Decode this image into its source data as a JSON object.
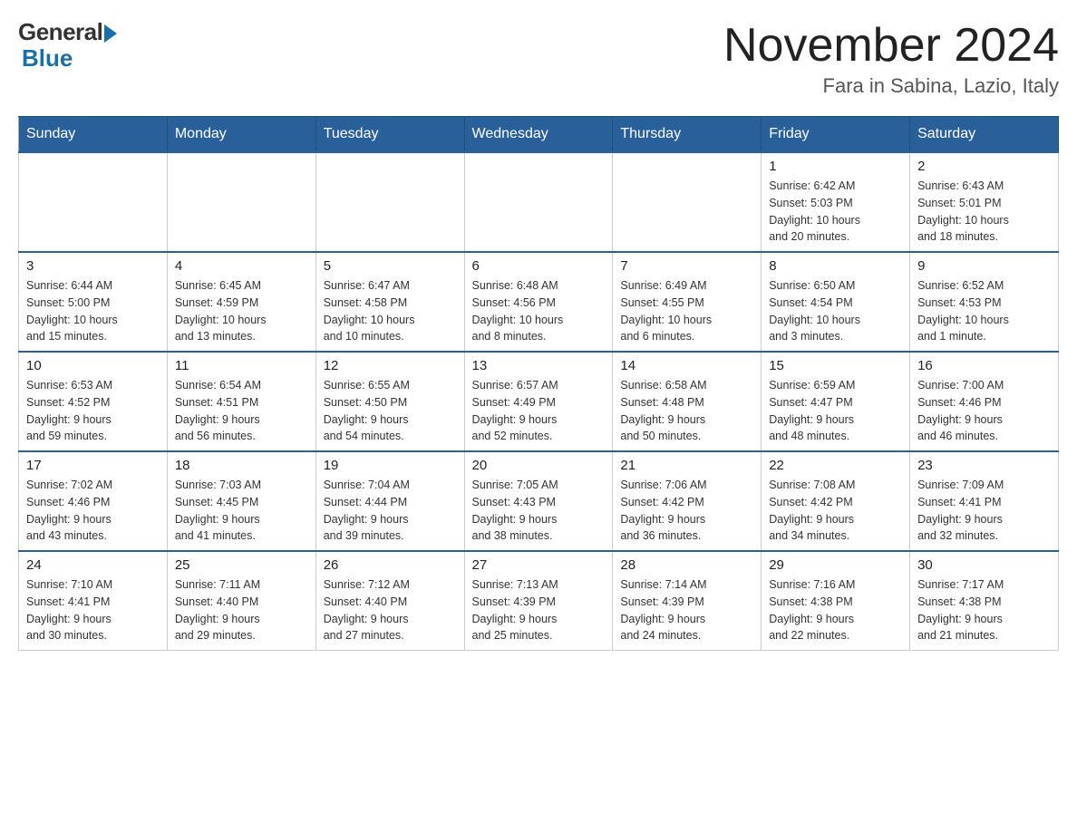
{
  "logo": {
    "general_text": "General",
    "blue_text": "Blue"
  },
  "header": {
    "title": "November 2024",
    "location": "Fara in Sabina, Lazio, Italy"
  },
  "days_of_week": [
    "Sunday",
    "Monday",
    "Tuesday",
    "Wednesday",
    "Thursday",
    "Friday",
    "Saturday"
  ],
  "weeks": [
    [
      {
        "day": "",
        "info": ""
      },
      {
        "day": "",
        "info": ""
      },
      {
        "day": "",
        "info": ""
      },
      {
        "day": "",
        "info": ""
      },
      {
        "day": "",
        "info": ""
      },
      {
        "day": "1",
        "info": "Sunrise: 6:42 AM\nSunset: 5:03 PM\nDaylight: 10 hours\nand 20 minutes."
      },
      {
        "day": "2",
        "info": "Sunrise: 6:43 AM\nSunset: 5:01 PM\nDaylight: 10 hours\nand 18 minutes."
      }
    ],
    [
      {
        "day": "3",
        "info": "Sunrise: 6:44 AM\nSunset: 5:00 PM\nDaylight: 10 hours\nand 15 minutes."
      },
      {
        "day": "4",
        "info": "Sunrise: 6:45 AM\nSunset: 4:59 PM\nDaylight: 10 hours\nand 13 minutes."
      },
      {
        "day": "5",
        "info": "Sunrise: 6:47 AM\nSunset: 4:58 PM\nDaylight: 10 hours\nand 10 minutes."
      },
      {
        "day": "6",
        "info": "Sunrise: 6:48 AM\nSunset: 4:56 PM\nDaylight: 10 hours\nand 8 minutes."
      },
      {
        "day": "7",
        "info": "Sunrise: 6:49 AM\nSunset: 4:55 PM\nDaylight: 10 hours\nand 6 minutes."
      },
      {
        "day": "8",
        "info": "Sunrise: 6:50 AM\nSunset: 4:54 PM\nDaylight: 10 hours\nand 3 minutes."
      },
      {
        "day": "9",
        "info": "Sunrise: 6:52 AM\nSunset: 4:53 PM\nDaylight: 10 hours\nand 1 minute."
      }
    ],
    [
      {
        "day": "10",
        "info": "Sunrise: 6:53 AM\nSunset: 4:52 PM\nDaylight: 9 hours\nand 59 minutes."
      },
      {
        "day": "11",
        "info": "Sunrise: 6:54 AM\nSunset: 4:51 PM\nDaylight: 9 hours\nand 56 minutes."
      },
      {
        "day": "12",
        "info": "Sunrise: 6:55 AM\nSunset: 4:50 PM\nDaylight: 9 hours\nand 54 minutes."
      },
      {
        "day": "13",
        "info": "Sunrise: 6:57 AM\nSunset: 4:49 PM\nDaylight: 9 hours\nand 52 minutes."
      },
      {
        "day": "14",
        "info": "Sunrise: 6:58 AM\nSunset: 4:48 PM\nDaylight: 9 hours\nand 50 minutes."
      },
      {
        "day": "15",
        "info": "Sunrise: 6:59 AM\nSunset: 4:47 PM\nDaylight: 9 hours\nand 48 minutes."
      },
      {
        "day": "16",
        "info": "Sunrise: 7:00 AM\nSunset: 4:46 PM\nDaylight: 9 hours\nand 46 minutes."
      }
    ],
    [
      {
        "day": "17",
        "info": "Sunrise: 7:02 AM\nSunset: 4:46 PM\nDaylight: 9 hours\nand 43 minutes."
      },
      {
        "day": "18",
        "info": "Sunrise: 7:03 AM\nSunset: 4:45 PM\nDaylight: 9 hours\nand 41 minutes."
      },
      {
        "day": "19",
        "info": "Sunrise: 7:04 AM\nSunset: 4:44 PM\nDaylight: 9 hours\nand 39 minutes."
      },
      {
        "day": "20",
        "info": "Sunrise: 7:05 AM\nSunset: 4:43 PM\nDaylight: 9 hours\nand 38 minutes."
      },
      {
        "day": "21",
        "info": "Sunrise: 7:06 AM\nSunset: 4:42 PM\nDaylight: 9 hours\nand 36 minutes."
      },
      {
        "day": "22",
        "info": "Sunrise: 7:08 AM\nSunset: 4:42 PM\nDaylight: 9 hours\nand 34 minutes."
      },
      {
        "day": "23",
        "info": "Sunrise: 7:09 AM\nSunset: 4:41 PM\nDaylight: 9 hours\nand 32 minutes."
      }
    ],
    [
      {
        "day": "24",
        "info": "Sunrise: 7:10 AM\nSunset: 4:41 PM\nDaylight: 9 hours\nand 30 minutes."
      },
      {
        "day": "25",
        "info": "Sunrise: 7:11 AM\nSunset: 4:40 PM\nDaylight: 9 hours\nand 29 minutes."
      },
      {
        "day": "26",
        "info": "Sunrise: 7:12 AM\nSunset: 4:40 PM\nDaylight: 9 hours\nand 27 minutes."
      },
      {
        "day": "27",
        "info": "Sunrise: 7:13 AM\nSunset: 4:39 PM\nDaylight: 9 hours\nand 25 minutes."
      },
      {
        "day": "28",
        "info": "Sunrise: 7:14 AM\nSunset: 4:39 PM\nDaylight: 9 hours\nand 24 minutes."
      },
      {
        "day": "29",
        "info": "Sunrise: 7:16 AM\nSunset: 4:38 PM\nDaylight: 9 hours\nand 22 minutes."
      },
      {
        "day": "30",
        "info": "Sunrise: 7:17 AM\nSunset: 4:38 PM\nDaylight: 9 hours\nand 21 minutes."
      }
    ]
  ]
}
